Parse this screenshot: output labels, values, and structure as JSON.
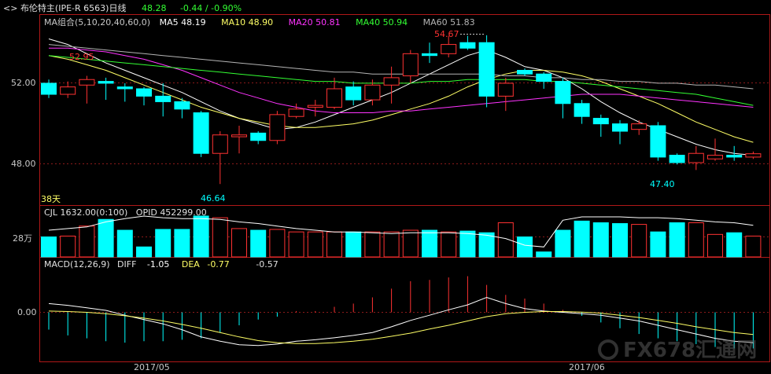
{
  "header": {
    "back_icon": "chevron-left-icon",
    "title": "布伦特主(IPE-R 6563)日线",
    "last": "48.28",
    "change": "-0.44 / -0.90%",
    "colors": {
      "title": "#e0e0e0",
      "last": "#ffffff",
      "change": "#33ff33"
    }
  },
  "ma_legend": {
    "name": "MA组合(5,10,20,40,60,0)",
    "items": [
      {
        "label": "MA5 48.19",
        "color": "#ffffff"
      },
      {
        "label": "MA10 48.90",
        "color": "#ffff66"
      },
      {
        "label": "MA20 50.81",
        "color": "#ff33ff"
      },
      {
        "label": "MA40 50.94",
        "color": "#33ff33"
      },
      {
        "label": "MA60 51.83",
        "color": "#b4b4b4"
      }
    ]
  },
  "vol_legend": {
    "text": "CJL 1632.00(0:100)   OPID 452299.00"
  },
  "macd_legend": {
    "name": "MACD(12,26,9)",
    "diff_label": "DIFF",
    "diff": "-1.05",
    "dea_label": "DEA",
    "dea": "-0.77",
    "macd": "-0.57"
  },
  "axis": {
    "price_ticks": [
      "52.00",
      "48.00"
    ],
    "vol_tick": "28万",
    "macd_tick": "0.00",
    "dates": [
      "2017/05",
      "2017/06"
    ],
    "days_label": "38天"
  },
  "annotations": {
    "high_left": "52.95",
    "high_mid": "54.67",
    "low_left": "46.64",
    "low_right": "47.40"
  },
  "watermark": "FX678汇通网",
  "chart_data": {
    "type": "candlestick",
    "title": "布伦特主(IPE-R 6563)日线",
    "ylim": [
      45.5,
      55.8
    ],
    "candles": [
      {
        "o": 52.1,
        "h": 52.3,
        "l": 51.3,
        "c": 51.5
      },
      {
        "o": 51.5,
        "h": 52.2,
        "l": 51.3,
        "c": 51.9
      },
      {
        "o": 52.0,
        "h": 52.5,
        "l": 51.0,
        "c": 52.3
      },
      {
        "o": 52.2,
        "h": 52.4,
        "l": 51.2,
        "c": 52.1
      },
      {
        "o": 51.9,
        "h": 52.1,
        "l": 51.1,
        "c": 51.8
      },
      {
        "o": 51.8,
        "h": 51.9,
        "l": 50.9,
        "c": 51.4
      },
      {
        "o": 51.4,
        "h": 52.1,
        "l": 50.3,
        "c": 51.1
      },
      {
        "o": 51.1,
        "h": 51.3,
        "l": 50.2,
        "c": 50.7
      },
      {
        "o": 50.5,
        "h": 50.6,
        "l": 48.1,
        "c": 48.3
      },
      {
        "o": 48.3,
        "h": 49.5,
        "l": 46.64,
        "c": 49.3
      },
      {
        "o": 49.2,
        "h": 49.8,
        "l": 48.3,
        "c": 49.3
      },
      {
        "o": 49.4,
        "h": 49.5,
        "l": 48.8,
        "c": 49.0
      },
      {
        "o": 49.0,
        "h": 50.6,
        "l": 48.8,
        "c": 50.4
      },
      {
        "o": 50.3,
        "h": 51.0,
        "l": 50.2,
        "c": 50.7
      },
      {
        "o": 50.8,
        "h": 51.2,
        "l": 50.3,
        "c": 50.9
      },
      {
        "o": 50.8,
        "h": 52.4,
        "l": 50.7,
        "c": 51.8
      },
      {
        "o": 51.9,
        "h": 52.2,
        "l": 50.9,
        "c": 51.2
      },
      {
        "o": 51.2,
        "h": 52.3,
        "l": 50.9,
        "c": 52.0
      },
      {
        "o": 52.0,
        "h": 53.0,
        "l": 51.0,
        "c": 52.4
      },
      {
        "o": 52.5,
        "h": 53.9,
        "l": 52.1,
        "c": 53.7
      },
      {
        "o": 53.7,
        "h": 54.3,
        "l": 53.2,
        "c": 53.6
      },
      {
        "o": 53.7,
        "h": 54.67,
        "l": 53.5,
        "c": 54.2
      },
      {
        "o": 54.3,
        "h": 54.67,
        "l": 53.9,
        "c": 54.0
      },
      {
        "o": 54.3,
        "h": 54.7,
        "l": 50.8,
        "c": 51.4
      },
      {
        "o": 51.4,
        "h": 52.4,
        "l": 50.6,
        "c": 52.1
      },
      {
        "o": 52.8,
        "h": 52.9,
        "l": 52.5,
        "c": 52.6
      },
      {
        "o": 52.6,
        "h": 52.7,
        "l": 51.8,
        "c": 52.2
      },
      {
        "o": 52.2,
        "h": 52.4,
        "l": 50.2,
        "c": 51.0
      },
      {
        "o": 51.0,
        "h": 51.2,
        "l": 49.9,
        "c": 50.3
      },
      {
        "o": 50.2,
        "h": 50.4,
        "l": 49.2,
        "c": 49.9
      },
      {
        "o": 49.9,
        "h": 50.1,
        "l": 48.8,
        "c": 49.5
      },
      {
        "o": 49.6,
        "h": 50.1,
        "l": 49.3,
        "c": 49.9
      },
      {
        "o": 49.8,
        "h": 50.0,
        "l": 47.9,
        "c": 48.1
      },
      {
        "o": 48.2,
        "h": 48.3,
        "l": 47.7,
        "c": 47.8
      },
      {
        "o": 47.8,
        "h": 48.7,
        "l": 47.4,
        "c": 48.3
      },
      {
        "o": 48.0,
        "h": 49.1,
        "l": 47.9,
        "c": 48.2
      },
      {
        "o": 48.2,
        "h": 48.7,
        "l": 47.9,
        "c": 48.1
      },
      {
        "o": 48.1,
        "h": 48.4,
        "l": 48.0,
        "c": 48.28
      }
    ],
    "ma": [
      {
        "name": "MA5",
        "color": "#ffffff",
        "values": [
          54.5,
          54.2,
          53.7,
          53.2,
          52.8,
          52.4,
          52.0,
          51.6,
          51.1,
          50.6,
          50.2,
          49.9,
          49.6,
          49.7,
          50.0,
          50.4,
          50.8,
          51.2,
          51.6,
          52.1,
          52.6,
          53.1,
          53.6,
          53.9,
          53.5,
          53.0,
          52.8,
          52.4,
          51.8,
          51.1,
          50.5,
          50.0,
          49.6,
          49.2,
          48.8,
          48.5,
          48.3,
          48.2
        ]
      },
      {
        "name": "MA10",
        "color": "#ffff66",
        "values": [
          53.6,
          53.4,
          53.1,
          52.8,
          52.4,
          52.0,
          51.6,
          51.2,
          50.8,
          50.5,
          50.2,
          50.0,
          49.8,
          49.7,
          49.7,
          49.8,
          49.9,
          50.1,
          50.4,
          50.7,
          51.0,
          51.4,
          51.9,
          52.3,
          52.6,
          52.8,
          52.8,
          52.7,
          52.5,
          52.2,
          51.8,
          51.4,
          51.0,
          50.5,
          50.0,
          49.6,
          49.2,
          48.9
        ]
      },
      {
        "name": "MA20",
        "color": "#ff33ff",
        "values": [
          54.0,
          54.0,
          53.9,
          53.8,
          53.6,
          53.4,
          53.1,
          52.8,
          52.4,
          52.0,
          51.6,
          51.3,
          51.0,
          50.8,
          50.6,
          50.5,
          50.5,
          50.5,
          50.6,
          50.6,
          50.7,
          50.8,
          50.9,
          51.0,
          51.1,
          51.2,
          51.3,
          51.4,
          51.5,
          51.5,
          51.5,
          51.4,
          51.3,
          51.2,
          51.1,
          51.0,
          50.9,
          50.8
        ]
      },
      {
        "name": "MA40",
        "color": "#33ff33",
        "values": [
          53.6,
          53.5,
          53.4,
          53.3,
          53.2,
          53.1,
          53.0,
          52.9,
          52.8,
          52.7,
          52.6,
          52.5,
          52.4,
          52.3,
          52.2,
          52.2,
          52.1,
          52.1,
          52.1,
          52.1,
          52.2,
          52.2,
          52.3,
          52.3,
          52.3,
          52.3,
          52.2,
          52.2,
          52.1,
          52.0,
          51.9,
          51.8,
          51.7,
          51.6,
          51.5,
          51.3,
          51.1,
          50.9
        ]
      },
      {
        "name": "MA60",
        "color": "#b4b4b4",
        "values": [
          54.2,
          54.1,
          54.0,
          53.9,
          53.8,
          53.7,
          53.6,
          53.5,
          53.4,
          53.3,
          53.2,
          53.1,
          53.0,
          52.9,
          52.8,
          52.7,
          52.7,
          52.6,
          52.6,
          52.6,
          52.6,
          52.6,
          52.6,
          52.6,
          52.5,
          52.5,
          52.4,
          52.4,
          52.3,
          52.3,
          52.2,
          52.2,
          52.1,
          52.1,
          52.0,
          52.0,
          51.9,
          51.8
        ]
      }
    ],
    "volume": [
      24,
      25,
      37,
      45,
      32,
      12,
      33,
      33,
      49,
      47,
      34,
      32,
      33,
      30,
      30,
      30,
      30,
      30,
      30,
      32,
      32,
      30,
      31,
      29,
      41,
      24,
      6,
      32,
      43,
      41,
      40,
      39,
      30,
      41,
      41,
      27,
      29,
      25
    ],
    "vol_ylim": [
      0,
      65
    ],
    "vol_line": [
      32,
      34,
      36,
      42,
      46,
      49,
      47,
      46,
      46,
      45,
      42,
      40,
      37,
      34,
      32,
      30,
      30,
      29,
      28,
      29,
      29,
      29,
      28,
      26,
      22,
      14,
      12,
      44,
      48,
      48,
      48,
      47,
      47,
      46,
      44,
      42,
      41,
      38
    ],
    "macd_hist": [
      -0.6,
      -0.8,
      -0.9,
      -1.0,
      -1.05,
      -1.0,
      -1.0,
      -0.95,
      -0.9,
      -0.7,
      -0.45,
      -0.25,
      -0.15,
      0.05,
      0.05,
      0.22,
      0.35,
      0.6,
      0.95,
      1.25,
      1.3,
      1.4,
      1.45,
      1.1,
      0.7,
      0.55,
      0.35,
      0.1,
      -0.12,
      -0.35,
      -0.55,
      -0.75,
      -0.9,
      -1.0,
      -1.1,
      -1.2,
      -1.25,
      -1.25
    ],
    "macd_diff": [
      0.35,
      0.28,
      0.18,
      0.08,
      -0.1,
      -0.25,
      -0.4,
      -0.6,
      -0.85,
      -1.0,
      -1.12,
      -1.15,
      -1.1,
      -1.0,
      -0.95,
      -0.88,
      -0.8,
      -0.7,
      -0.5,
      -0.28,
      -0.1,
      0.1,
      0.3,
      0.6,
      0.35,
      0.15,
      0.05,
      0.0,
      -0.05,
      -0.1,
      -0.2,
      -0.3,
      -0.45,
      -0.6,
      -0.75,
      -0.9,
      -1.0,
      -1.05
    ],
    "macd_dea": [
      0.05,
      0.03,
      0.0,
      -0.05,
      -0.12,
      -0.2,
      -0.3,
      -0.42,
      -0.55,
      -0.7,
      -0.85,
      -0.98,
      -1.05,
      -1.08,
      -1.08,
      -1.05,
      -1.0,
      -0.93,
      -0.83,
      -0.72,
      -0.58,
      -0.45,
      -0.3,
      -0.15,
      -0.05,
      0.0,
      0.03,
      0.03,
      0.01,
      -0.03,
      -0.1,
      -0.18,
      -0.28,
      -0.38,
      -0.5,
      -0.6,
      -0.7,
      -0.77
    ],
    "macd_ylim": [
      -1.7,
      1.75
    ],
    "colors": {
      "up": "#ff3232",
      "down": "#00ffff",
      "grid": "#8b1a1a"
    }
  }
}
